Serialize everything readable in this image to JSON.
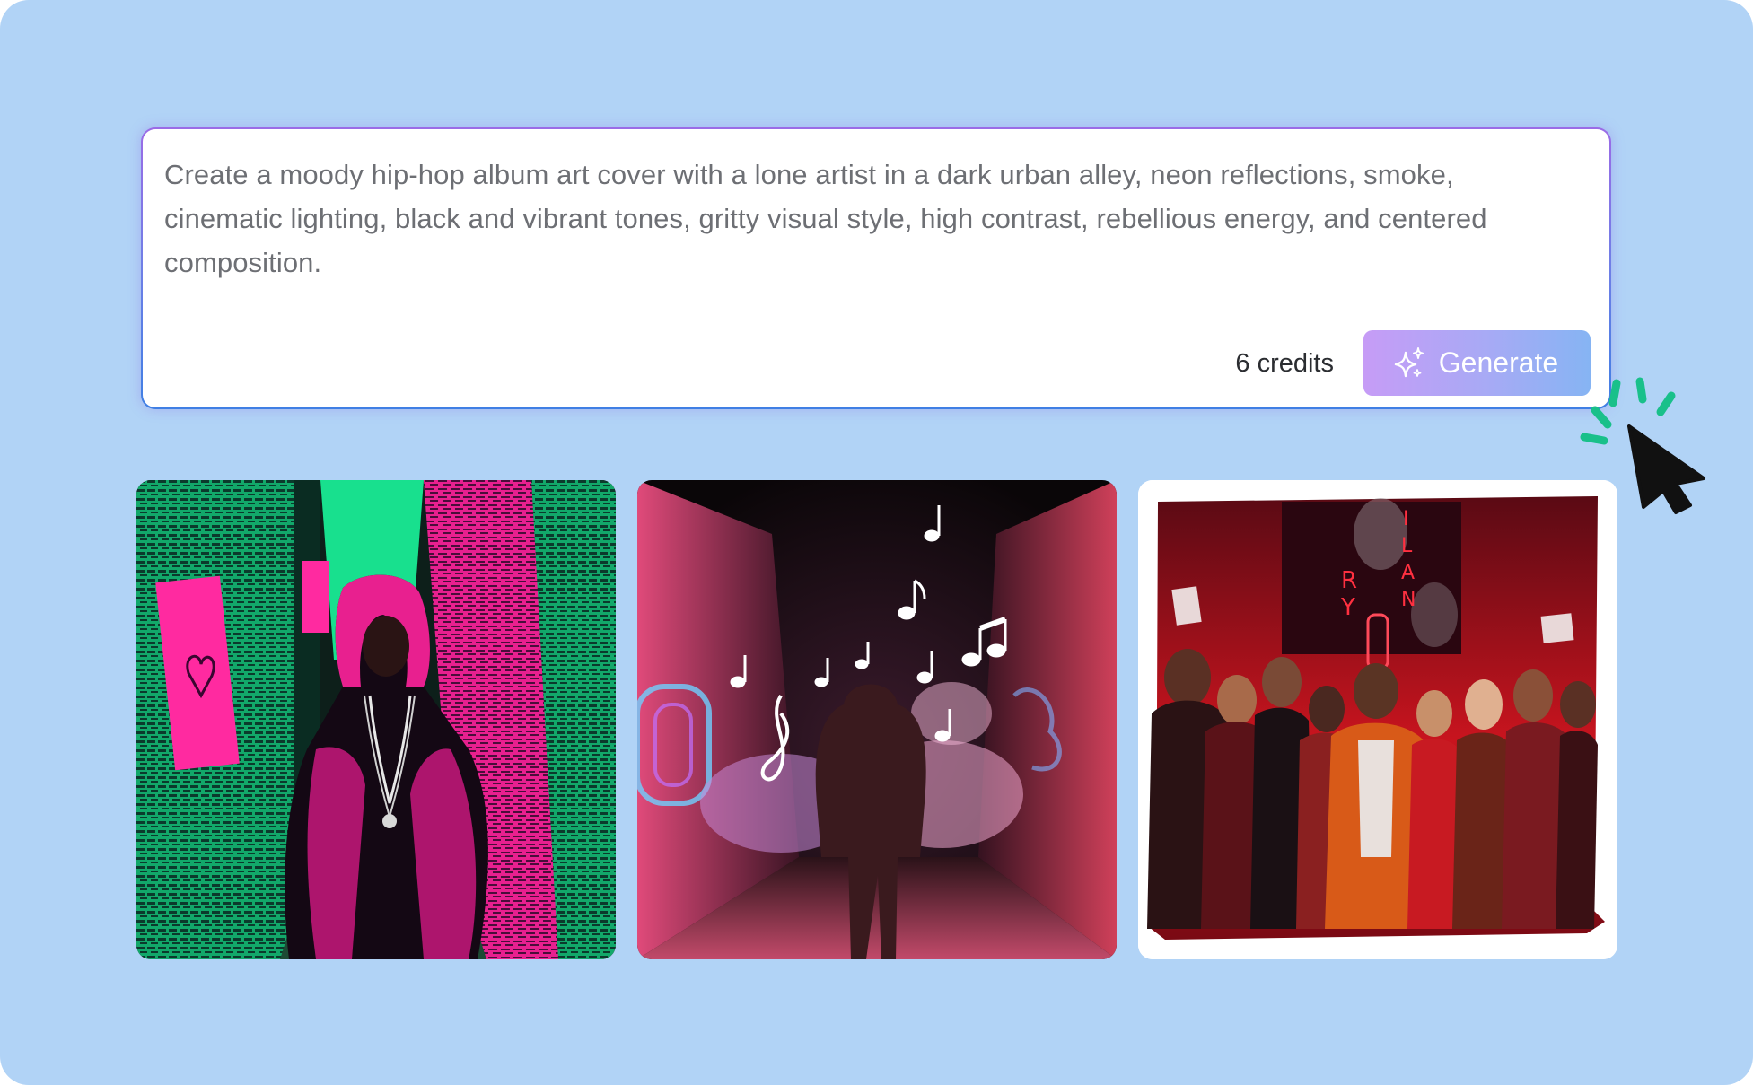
{
  "prompt": {
    "text": "Create a moody hip-hop album art cover with a lone artist in a dark urban alley, neon reflections, smoke, cinematic lighting, black and vibrant tones, gritty visual style, high contrast, rebellious energy, and centered composition."
  },
  "footer": {
    "credits_label": "6 credits",
    "generate_label": "Generate",
    "generate_icon": "sparkles-icon"
  },
  "gallery": {
    "images": [
      {
        "name": "album-art-neon-alley-hooded-artist",
        "accent": "#ff1f9c",
        "secondary": "#18e08e"
      },
      {
        "name": "album-art-smoke-alley-music-notes",
        "accent": "#e6387a",
        "secondary": "#3fa9ff"
      },
      {
        "name": "album-art-crowd-red-neon-alley",
        "accent": "#d51a22",
        "secondary": "#ffffff"
      }
    ]
  },
  "cursor": {
    "icon": "mouse-pointer-icon",
    "click_burst_color": "#19c08a"
  },
  "colors": {
    "background": "#b1d3f6",
    "button_start": "#c69cf6",
    "button_end": "#86b4f3"
  }
}
